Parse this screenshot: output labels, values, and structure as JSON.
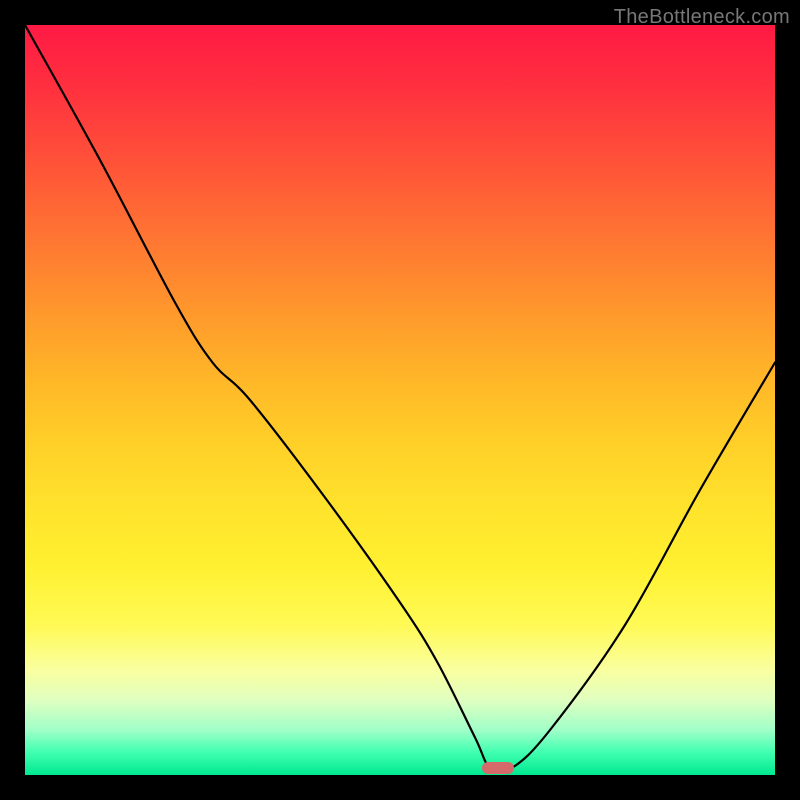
{
  "watermark": "TheBottleneck.com",
  "chart_data": {
    "type": "line",
    "title": "",
    "xlabel": "",
    "ylabel": "",
    "xlim": [
      0,
      100
    ],
    "ylim": [
      0,
      100
    ],
    "grid": false,
    "legend": false,
    "series": [
      {
        "name": "bottleneck-curve",
        "x": [
          0,
          10,
          20,
          25,
          30,
          40,
          50,
          55,
          60,
          62,
          65,
          70,
          80,
          90,
          100
        ],
        "values": [
          100,
          82,
          63,
          55,
          50,
          37,
          23,
          15,
          5,
          1,
          1,
          6,
          20,
          38,
          55
        ]
      }
    ],
    "gradient_stops": [
      {
        "offset": 0,
        "color": "#ff1a44"
      },
      {
        "offset": 50,
        "color": "#ffd028"
      },
      {
        "offset": 85,
        "color": "#fffa55"
      },
      {
        "offset": 100,
        "color": "#00e890"
      }
    ],
    "optimal_marker": {
      "x": 63,
      "y": 1,
      "color": "#d46a6a"
    }
  }
}
